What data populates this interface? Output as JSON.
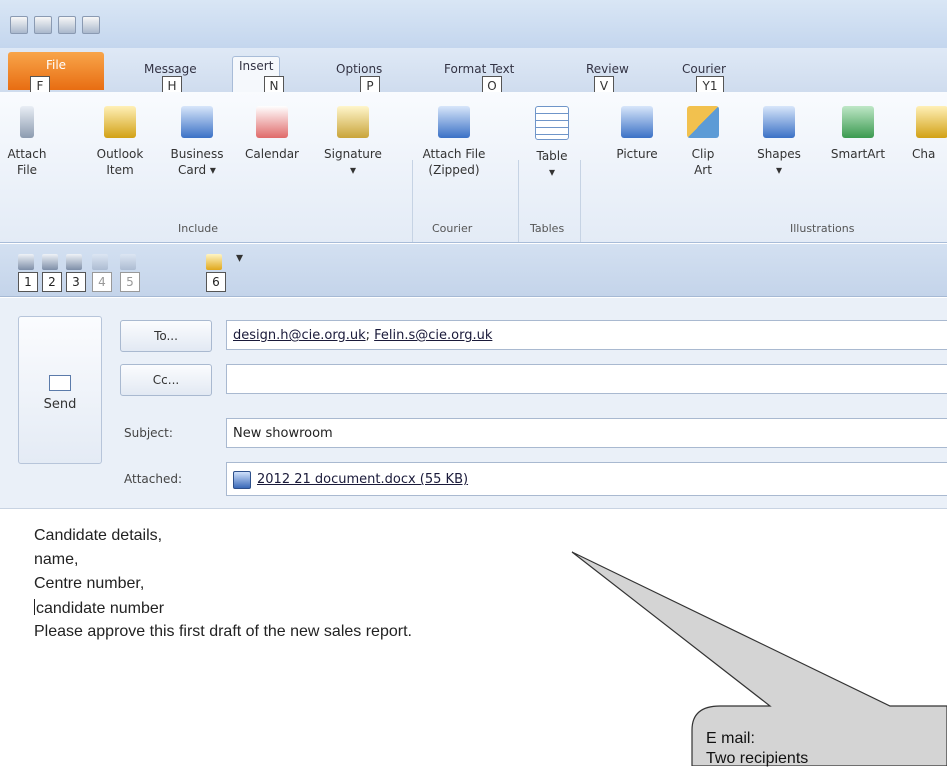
{
  "ribbon_tabs": [
    {
      "label": "File",
      "keytip": "F"
    },
    {
      "label": "Message",
      "keytip": "H"
    },
    {
      "label": "Insert",
      "keytip": "N"
    },
    {
      "label": "Options",
      "keytip": "P"
    },
    {
      "label": "Format Text",
      "keytip": "O"
    },
    {
      "label": "Review",
      "keytip": "V"
    },
    {
      "label": "Courier",
      "keytip": "Y1"
    }
  ],
  "ribbon_buttons": {
    "attach_file": [
      "Attach",
      "File"
    ],
    "outlook_item": [
      "Outlook",
      "Item"
    ],
    "business_card": [
      "Business",
      "Card ▾"
    ],
    "calendar": [
      "Calendar",
      ""
    ],
    "signature": [
      "Signature",
      "▾"
    ],
    "attach_zipped": [
      "Attach File",
      "(Zipped)"
    ],
    "table": [
      "Table",
      "▾"
    ],
    "picture": [
      "Picture",
      ""
    ],
    "clip_art": [
      "Clip",
      "Art"
    ],
    "shapes": [
      "Shapes",
      "▾"
    ],
    "smartart": [
      "SmartArt",
      ""
    ],
    "chart": [
      "Cha",
      ""
    ]
  },
  "ribbon_groups": {
    "include": "Include",
    "courier": "Courier",
    "tables": "Tables",
    "illustrations": "Illustrations"
  },
  "qat_keytips": [
    "1",
    "2",
    "3",
    "4",
    "5",
    "6"
  ],
  "qat_dropdown": "▾",
  "compose": {
    "send_label": "Send",
    "to_button": "To...",
    "cc_button": "Cc...",
    "subject_label": "Subject:",
    "attached_label": "Attached:",
    "to_recipient_1": "design.h@cie.org.uk",
    "to_separator": "; ",
    "to_recipient_2": "Felin.s@cie.org.uk",
    "cc_value": "",
    "subject_value": "New showroom",
    "attachment": "2012 21 document.docx (55 KB)"
  },
  "message_body": [
    "Candidate details,",
    "name,",
    "Centre number,",
    "candidate number",
    "Please approve this first draft of the new sales report."
  ],
  "callout": {
    "line1": "E mail:",
    "line2": "Two recipients"
  }
}
